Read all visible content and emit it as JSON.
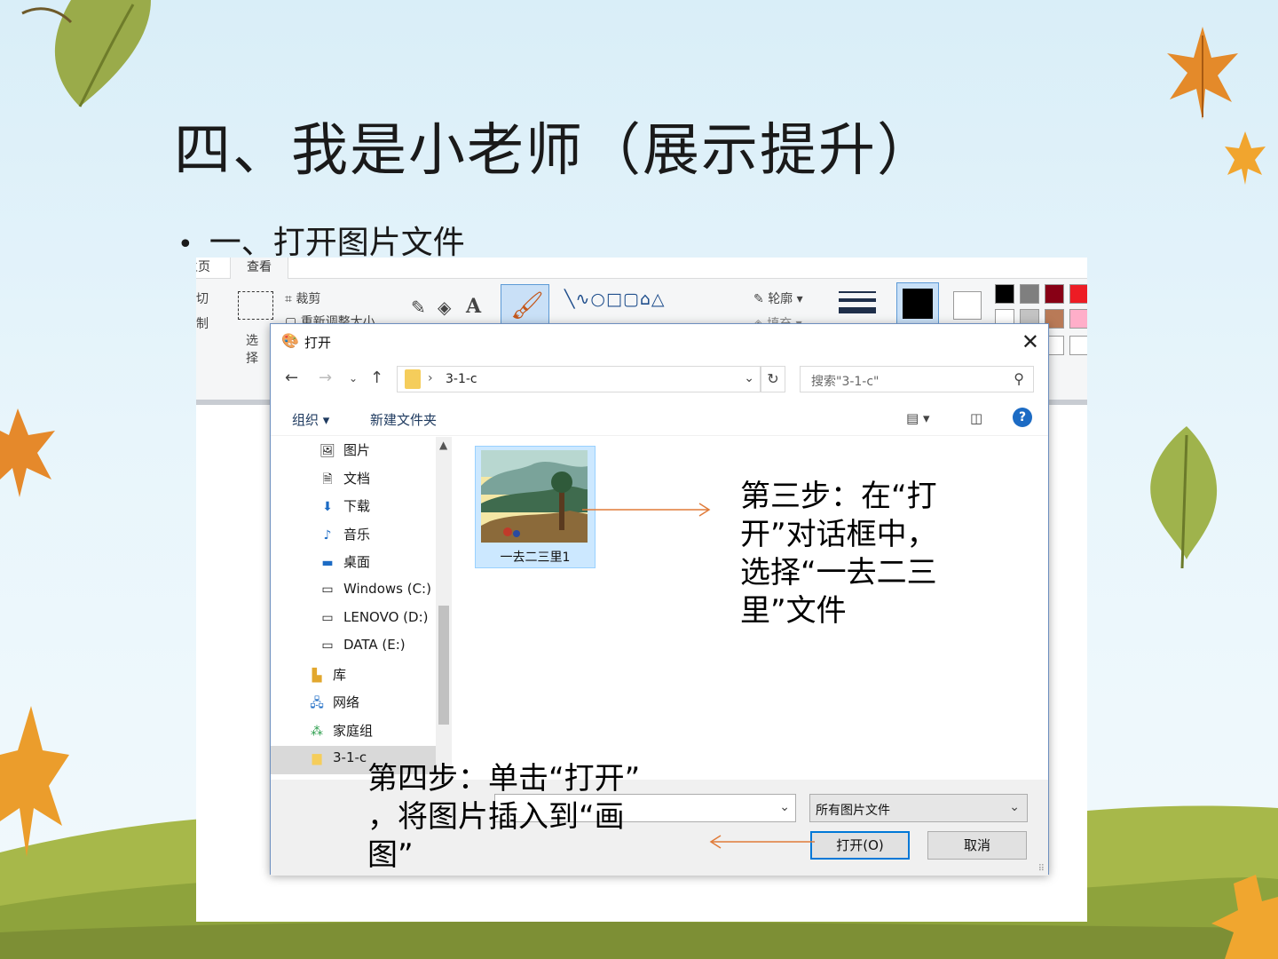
{
  "slide": {
    "title": "四、我是小老师（展示提升）",
    "bullet": "一、打开图片文件"
  },
  "paint": {
    "tabs": [
      "主页",
      "查看"
    ],
    "ribbon": {
      "cut": "剪切",
      "copy": "复制",
      "select": "选择",
      "crop": "裁剪",
      "resize": "重新调整大小",
      "outline": "轮廓",
      "fill": "填充"
    },
    "palette": [
      "#000000",
      "#7f7f7f",
      "#880015",
      "#ed1c24",
      "#ffffff",
      "#c3c3c3",
      "#b97a57",
      "#ffaec9"
    ]
  },
  "dialog": {
    "title": "打开",
    "address": "3-1-c",
    "search_placeholder": "搜索\"3-1-c\"",
    "organize": "组织 ▾",
    "new_folder": "新建文件夹",
    "help": "?",
    "nav_items": [
      {
        "label": "图片",
        "icon": "pictures-icon"
      },
      {
        "label": "文档",
        "icon": "documents-icon"
      },
      {
        "label": "下载",
        "icon": "downloads-icon"
      },
      {
        "label": "音乐",
        "icon": "music-icon"
      },
      {
        "label": "桌面",
        "icon": "desktop-icon"
      },
      {
        "label": "Windows (C:)",
        "icon": "drive-c-icon"
      },
      {
        "label": "LENOVO (D:)",
        "icon": "drive-d-icon"
      },
      {
        "label": "DATA (E:)",
        "icon": "drive-e-icon"
      },
      {
        "label": "库",
        "icon": "library-icon"
      },
      {
        "label": "网络",
        "icon": "network-icon"
      },
      {
        "label": "家庭组",
        "icon": "homegroup-icon"
      },
      {
        "label": "3-1-c",
        "icon": "folder-icon"
      }
    ],
    "file": {
      "name": "一去二三里1"
    },
    "filename_value": "",
    "filetype": "所有图片文件",
    "open_button": "打开(O)",
    "cancel_button": "取消"
  },
  "annotations": {
    "step3": [
      "第三步：在“打",
      "开”对话框中，",
      "选择“一去二三",
      "里”文件"
    ],
    "step4": [
      "第四步：单击“打开”",
      "，将图片插入到“画",
      "图”"
    ]
  }
}
